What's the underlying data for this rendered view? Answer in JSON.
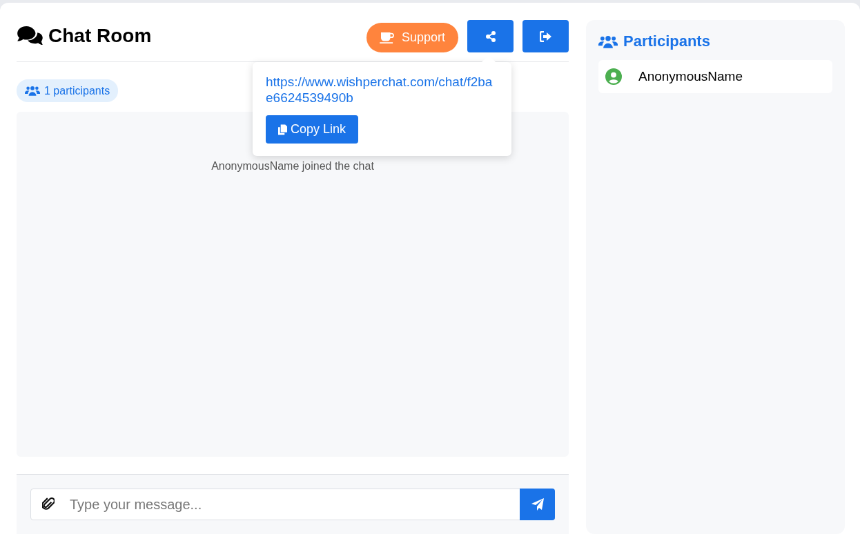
{
  "header": {
    "title": "Chat Room",
    "support_button": "Support"
  },
  "share_popover": {
    "open": true,
    "link": "https://www.wishperchat.com/chat/f2bae6624539490b",
    "copy_button": "Copy Link"
  },
  "participant_count": "1 participants",
  "messages": [
    {
      "kind": "system",
      "text": "AnonymousName joined the chat"
    }
  ],
  "composer": {
    "placeholder": "Type your message..."
  },
  "sidebar": {
    "title": "Participants",
    "participants": [
      {
        "name": "AnonymousName",
        "color": "#4caf50"
      }
    ]
  }
}
